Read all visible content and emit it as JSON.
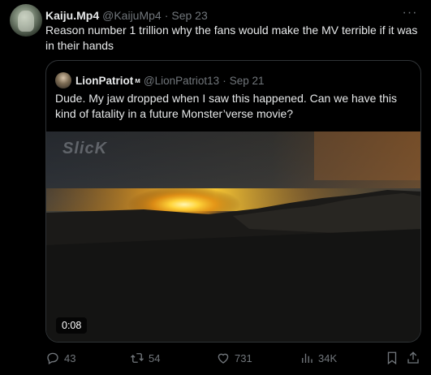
{
  "post": {
    "author_name": "Kaiju.Mp4",
    "author_handle": "@KaijuMp4",
    "separator": "·",
    "date": "Sep 23",
    "more_label": "···",
    "text": "Reason number 1 trillion why the fans would make the MV terrible if it was in their hands"
  },
  "quote": {
    "author_name": "LionPatriot",
    "author_badge": "ᴍ",
    "author_handle": "@LionPatriot13",
    "separator": "·",
    "date": "Sep 21",
    "text": "Dude. My jaw dropped when I saw this happened. Can we have this kind of fatality in a future Monster’verse movie?",
    "video": {
      "watermark": "SlicK",
      "duration": "0:08"
    }
  },
  "actions": {
    "replies": "43",
    "reposts": "54",
    "likes": "731",
    "views": "34K"
  },
  "icons": {
    "reply": "reply-icon",
    "repost": "repost-icon",
    "like": "heart-icon",
    "views": "analytics-icon",
    "bookmark": "bookmark-icon",
    "share": "share-icon"
  },
  "colors": {
    "background": "#000000",
    "text_primary": "#e7e9ea",
    "text_secondary": "#71767b",
    "border": "#2f3336"
  }
}
